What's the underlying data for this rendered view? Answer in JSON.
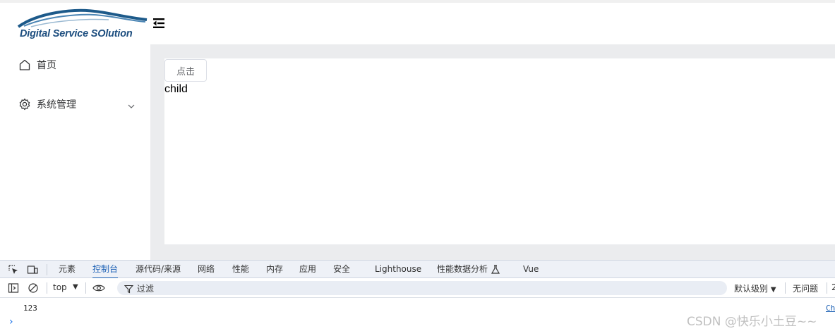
{
  "header": {
    "logo_text": "Digital Service SOlution",
    "collapse_icon": "menu-fold-icon"
  },
  "sidebar": {
    "items": [
      {
        "label": "首页",
        "icon": "home-icon"
      },
      {
        "label": "系统管理",
        "icon": "gear-icon",
        "arrow": "chevron-down-icon"
      }
    ]
  },
  "main": {
    "button_label": "点击",
    "child_text": "child"
  },
  "devtools": {
    "tabs": [
      "元素",
      "控制台",
      "源代码/来源",
      "网络",
      "性能",
      "内存",
      "应用",
      "安全",
      "Lighthouse",
      "性能数据分析",
      "Vue"
    ],
    "active_tab": "控制台",
    "toolbar": {
      "context": "top",
      "filter_placeholder": "过滤",
      "level": "默认级别",
      "issues": "无问题",
      "extra": "2"
    },
    "console": {
      "lines": [
        "123"
      ],
      "source_link": "Ch"
    }
  },
  "watermark": "CSDN @快乐小土豆~~",
  "colors": {
    "accent": "#1a5fb4",
    "logo": "#1d4e7f",
    "main_bg": "#ebecee",
    "devtools_bar": "#eef1f7"
  }
}
